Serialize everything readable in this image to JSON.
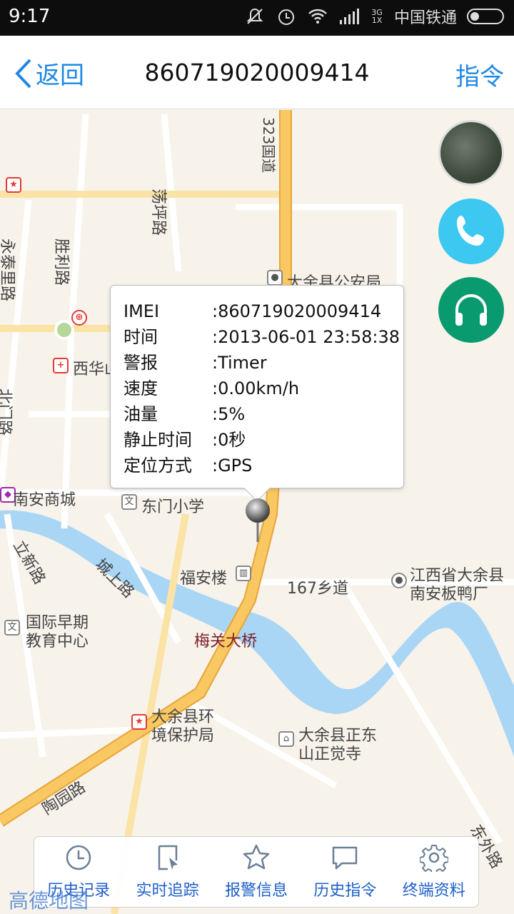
{
  "status_bar": {
    "time": "9:17",
    "network": "3G\n1X",
    "carrier": "中国铁通"
  },
  "header": {
    "back_label": "返回",
    "title": "860719020009414",
    "command_label": "指令"
  },
  "map": {
    "labels": {
      "road_323": "323国道",
      "dangping_road": "荡坪路",
      "shengli_road": "胜利路",
      "yongtai_road": "永泰里路",
      "public_security": "大余县公安局",
      "xihua": "西华山",
      "nanan_mall": "南安商城",
      "dongmen_school": "东门小学",
      "lixin_road": "立新路",
      "chengshang_road": "城上路",
      "fuan_building": "福安楼",
      "township_road": "167乡道",
      "jiangxi_factory_1": "江西省大余县",
      "jiangxi_factory_2": "南安板鸭厂",
      "early_edu_1": "国际早期",
      "early_edu_2": "教育中心",
      "meiguan_bridge": "梅关大桥",
      "env_bureau_1": "大余县环",
      "env_bureau_2": "境保护局",
      "temple_1": "大余县正东",
      "temple_2": "山正觉寺",
      "taoyuan_road": "陶园路",
      "dongwai_road": "东外路",
      "left_road": "北门路"
    },
    "logo": "高德地图"
  },
  "popup": {
    "rows": [
      {
        "key": "IMEI",
        "value": ":860719020009414"
      },
      {
        "key": "时间",
        "value": ":2013-06-01 23:58:38"
      },
      {
        "key": "警报",
        "value": ":Timer"
      },
      {
        "key": "速度",
        "value": ":0.00km/h"
      },
      {
        "key": "油量",
        "value": ":5%"
      },
      {
        "key": "静止时间",
        "value": ":0秒"
      },
      {
        "key": "定位方式",
        "value": ":GPS"
      }
    ]
  },
  "toolbar": {
    "items": [
      {
        "label": "历史记录",
        "icon": "clock-icon"
      },
      {
        "label": "实时追踪",
        "icon": "tracking-icon"
      },
      {
        "label": "报警信息",
        "icon": "star-icon"
      },
      {
        "label": "历史指令",
        "icon": "message-icon"
      },
      {
        "label": "终端资料",
        "icon": "gear-icon"
      }
    ]
  },
  "colors": {
    "accent": "#1e88e5",
    "road_main": "#f9c862",
    "river": "#a9d6f5",
    "call_button": "#3cc8f0",
    "listen_button": "#0a9a6f"
  }
}
